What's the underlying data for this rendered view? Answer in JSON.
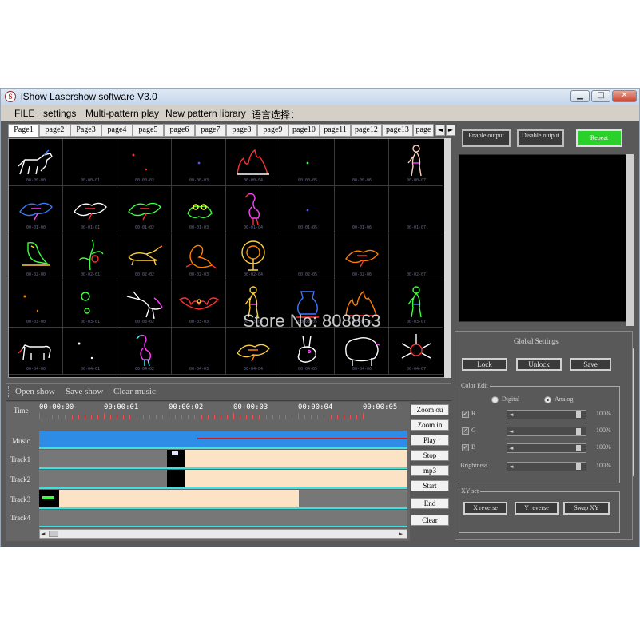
{
  "window": {
    "title": "iShow Lasershow software V3.0",
    "minimize": "▁",
    "maximize": "□",
    "close": "✕"
  },
  "menu": [
    "FILE",
    "settings",
    "Multi-pattern play",
    "New pattern library",
    "语言选择："
  ],
  "tabs": [
    "Page1",
    "page2",
    "Page3",
    "page4",
    "page5",
    "page6",
    "page7",
    "page8",
    "page9",
    "page10",
    "page11",
    "page12",
    "page13",
    "page"
  ],
  "tab_arrows": {
    "left": "◄",
    "right": "►"
  },
  "patterns": [
    {
      "t": "00-00-00",
      "c": [
        "#ffffff",
        "#3a7bff"
      ],
      "s": "horse"
    },
    {
      "t": "00-00-01",
      "c": [
        "#5555ff"
      ],
      "s": "none"
    },
    {
      "t": "00-00-02",
      "c": [
        "#ff3030"
      ],
      "s": "dots"
    },
    {
      "t": "00-00-03",
      "c": [
        "#5555ff"
      ],
      "s": "dot"
    },
    {
      "t": "00-00-04",
      "c": [
        "#ffffff",
        "#ff3030"
      ],
      "s": "flames"
    },
    {
      "t": "00-00-05",
      "c": [
        "#40ff40"
      ],
      "s": "dot"
    },
    {
      "t": "00-00-06",
      "c": [
        "#5555ff"
      ],
      "s": "none"
    },
    {
      "t": "00-00-07",
      "c": [
        "#ffd0c0",
        "#ff40ff"
      ],
      "s": "figure"
    },
    {
      "t": "00-01-00",
      "c": [
        "#3a7bff",
        "#ff40ff"
      ],
      "s": "bird"
    },
    {
      "t": "00-01-01",
      "c": [
        "#ffffff",
        "#ff3030"
      ],
      "s": "bird"
    },
    {
      "t": "00-01-02",
      "c": [
        "#40ff40",
        "#ff3030"
      ],
      "s": "bird"
    },
    {
      "t": "00-01-03",
      "c": [
        "#40ff40",
        "#ffff40"
      ],
      "s": "frog"
    },
    {
      "t": "00-01-04",
      "c": [
        "#ff40ff",
        "#ff3030"
      ],
      "s": "flamingo"
    },
    {
      "t": "00-01-05",
      "c": [
        "#5555ff"
      ],
      "s": "dot"
    },
    {
      "t": "00-01-06",
      "c": [
        "#5555ff"
      ],
      "s": "none"
    },
    {
      "t": "00-01-07",
      "c": [
        "#5555ff"
      ],
      "s": "none"
    },
    {
      "t": "00-02-00",
      "c": [
        "#40ff40",
        "#ffd040"
      ],
      "s": "parrot"
    },
    {
      "t": "00-02-01",
      "c": [
        "#40ff40",
        "#ff3030"
      ],
      "s": "plant"
    },
    {
      "t": "00-02-02",
      "c": [
        "#ffd040",
        "#ff8000"
      ],
      "s": "cat"
    },
    {
      "t": "00-02-03",
      "c": [
        "#ff8000",
        "#ff3030"
      ],
      "s": "scorpion"
    },
    {
      "t": "00-02-04",
      "c": [
        "#ffd040",
        "#ff8000"
      ],
      "s": "peacock"
    },
    {
      "t": "00-02-05",
      "c": [
        "#5555ff"
      ],
      "s": "none"
    },
    {
      "t": "00-02-06",
      "c": [
        "#ff8000",
        "#ff3030"
      ],
      "s": "bird"
    },
    {
      "t": "00-02-07",
      "c": [
        "#5555ff"
      ],
      "s": "none"
    },
    {
      "t": "00-03-00",
      "c": [
        "#ff8000"
      ],
      "s": "dots"
    },
    {
      "t": "00-03-01",
      "c": [
        "#40ff40"
      ],
      "s": "rings"
    },
    {
      "t": "00-03-02",
      "c": [
        "#ffffff",
        "#ff40ff"
      ],
      "s": "stork"
    },
    {
      "t": "00-03-03",
      "c": [
        "#ff3030",
        "#ffd040"
      ],
      "s": "bat"
    },
    {
      "t": "00-03-04",
      "c": [
        "#ffd040",
        "#ff40ff"
      ],
      "s": "figure"
    },
    {
      "t": "00-03-05",
      "c": [
        "#3a7bff",
        "#ff3030"
      ],
      "s": "vase"
    },
    {
      "t": "00-03-06",
      "c": [
        "#ff3030",
        "#ff8000"
      ],
      "s": "flames"
    },
    {
      "t": "00-03-07",
      "c": [
        "#40ff40",
        "#3a7bff"
      ],
      "s": "figure"
    },
    {
      "t": "00-04-00",
      "c": [
        "#ffffff",
        "#ff3030"
      ],
      "s": "dog"
    },
    {
      "t": "00-04-01",
      "c": [
        "#ffffff"
      ],
      "s": "dots"
    },
    {
      "t": "00-04-02",
      "c": [
        "#ff40ff",
        "#40ffff"
      ],
      "s": "flamingo"
    },
    {
      "t": "00-04-03",
      "c": [
        "#5555ff"
      ],
      "s": "none"
    },
    {
      "t": "00-04-04",
      "c": [
        "#ffd040",
        "#ff8000"
      ],
      "s": "bird"
    },
    {
      "t": "00-04-05",
      "c": [
        "#ffffff",
        "#ff40ff"
      ],
      "s": "rabbit"
    },
    {
      "t": "00-04-06",
      "c": [
        "#ffffff",
        "#ff40ff"
      ],
      "s": "sheep"
    },
    {
      "t": "00-04-07",
      "c": [
        "#ff3030",
        "#ffffff"
      ],
      "s": "spider"
    }
  ],
  "watermark": "Store No: 808863",
  "show_toolbar": [
    "Open show",
    "Save show",
    "Clear music"
  ],
  "timeline": {
    "time_label": "Time",
    "ticks": [
      "00:00:00",
      "00:00:01",
      "00:00:02",
      "00:00:03",
      "00:00:04",
      "00:00:05"
    ],
    "rows": [
      "Music",
      "Track1",
      "Track2",
      "Track3",
      "Track4"
    ]
  },
  "timeline_buttons": [
    "Zoom ou",
    "Zoom in",
    "Play",
    "Stop",
    "mp3",
    "Start",
    "End",
    "Clear"
  ],
  "output": {
    "enable": "Enable output",
    "disable": "Disable output",
    "repeat": "Repeat"
  },
  "global_settings": {
    "title": "Global Settings",
    "lock": "Lock",
    "unlock": "Unlock",
    "save": "Save",
    "color_edit": "Color Edit",
    "digital": "Digital",
    "analog": "Analog",
    "sliders": [
      {
        "label": "R",
        "pct": "100%",
        "level": 1.0
      },
      {
        "label": "G",
        "pct": "100%",
        "level": 1.0
      },
      {
        "label": "B",
        "pct": "100%",
        "level": 1.0
      },
      {
        "label": "Brightness",
        "pct": "100%",
        "level": 1.0
      }
    ],
    "xy_set": "XY set",
    "x_reverse": "X reverse",
    "y_reverse": "Y reverse",
    "swap_xy": "Swap XY"
  },
  "scroll": {
    "left": "◄",
    "right": "►",
    "up": "▲",
    "down": "▼"
  },
  "colors": {
    "repeat_green": "#2bd12b",
    "music_blue": "#2e8be6",
    "track_cyan": "#3fe0e0",
    "block_peach": "#fde3c6"
  }
}
